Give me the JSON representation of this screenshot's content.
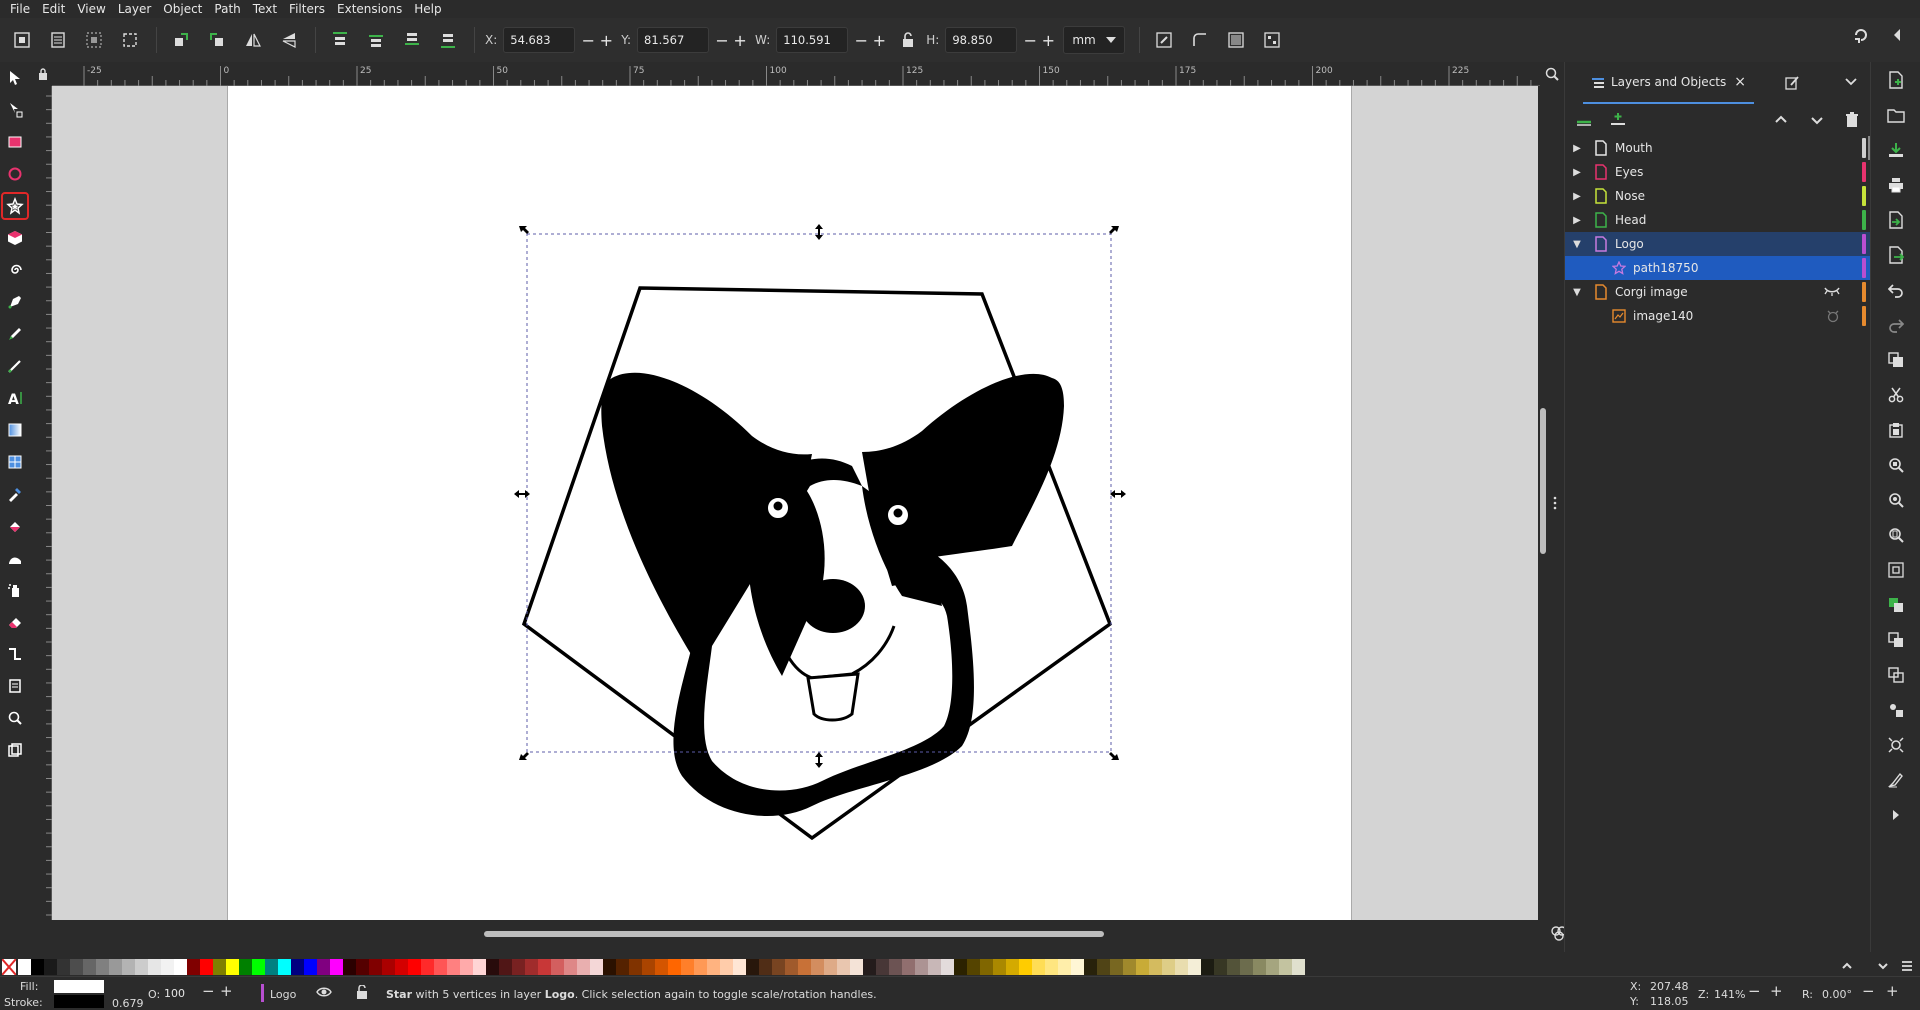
{
  "menu": [
    "File",
    "Edit",
    "View",
    "Layer",
    "Object",
    "Path",
    "Text",
    "Filters",
    "Extensions",
    "Help"
  ],
  "toolbar": {
    "x_label": "X:",
    "x_value": "54.683",
    "y_label": "Y:",
    "y_value": "81.567",
    "w_label": "W:",
    "w_value": "110.591",
    "h_label": "H:",
    "h_value": "98.850",
    "unit": "mm",
    "minus": "−",
    "plus": "+"
  },
  "ruler": {
    "top_ticks": [
      "-25",
      "0",
      "25",
      "50",
      "75",
      "100",
      "125",
      "150",
      "175",
      "200",
      "225"
    ]
  },
  "dock": {
    "tab_label": "Layers and Objects",
    "tab_close": "×",
    "layers": [
      {
        "name": "Mouth",
        "expander": "▶",
        "color": "#cfcfcf",
        "icon_color": "#e6e6e6"
      },
      {
        "name": "Eyes",
        "expander": "▶",
        "color": "#e8336e",
        "icon_color": "#e8336e"
      },
      {
        "name": "Nose",
        "expander": "▶",
        "color": "#c6e33a",
        "icon_color": "#c6e33a"
      },
      {
        "name": "Head",
        "expander": "▶",
        "color": "#3db34a",
        "icon_color": "#3db34a"
      },
      {
        "name": "Logo",
        "expander": "▼",
        "color": "#b84fd1",
        "icon_color": "#c77ae0"
      },
      {
        "name": "path18750",
        "expander": "",
        "color": "#b84fd1",
        "icon_color": "#c77ae0"
      },
      {
        "name": "Corgi image",
        "expander": "▼",
        "color": "#e68a2e",
        "icon_color": "#e68a2e"
      },
      {
        "name": "image140",
        "expander": "",
        "color": "#e68a2e",
        "icon_color": "#e68a2e"
      }
    ]
  },
  "status": {
    "fill_label": "Fill:",
    "stroke_label": "Stroke:",
    "stroke_width": "0.679",
    "opacity_label": "O:",
    "opacity_value": "100",
    "minus": "−",
    "plus": "+",
    "layer_name": "Logo",
    "message_bold": "Star",
    "message_rest": " with 5 vertices in layer ",
    "message_layer": "Logo",
    "message_tail": ". Click selection again to toggle scale/rotation handles.",
    "x_label": "X:",
    "x_value": "207.48",
    "y_label": "Y:",
    "y_value": "118.05",
    "zoom_label": "Z:",
    "zoom_value": "141%",
    "rot_label": "R:",
    "rot_value": "0.00°"
  },
  "palette": [
    "#ffffff",
    "#000000",
    "#1a1a1a",
    "#333333",
    "#4d4d4d",
    "#666666",
    "#808080",
    "#999999",
    "#b3b3b3",
    "#cccccc",
    "#e6e6e6",
    "#f2f2f2",
    "#ffffff",
    "#800000",
    "#ff0000",
    "#808000",
    "#ffff00",
    "#008000",
    "#00ff00",
    "#008080",
    "#00ffff",
    "#000080",
    "#0000ff",
    "#800080",
    "#ff00ff",
    "#2b0000",
    "#550000",
    "#800000",
    "#aa0000",
    "#d40000",
    "#ff0000",
    "#ff2a2a",
    "#ff5555",
    "#ff8080",
    "#ffaaaa",
    "#ffd5d5",
    "#280b0b",
    "#501616",
    "#782121",
    "#a02c2c",
    "#c83737",
    "#d35f5f",
    "#de8787",
    "#e9afaf",
    "#f4d7d7",
    "#2b1100",
    "#552200",
    "#803300",
    "#aa4400",
    "#d45500",
    "#ff6600",
    "#ff7f2a",
    "#ff9955",
    "#ffb380",
    "#ffccaa",
    "#ffe6d5",
    "#28170b",
    "#502d16",
    "#784421",
    "#a05a2c",
    "#c87137",
    "#d38d5f",
    "#deaa87",
    "#e9c6af",
    "#f4e3d7",
    "#241c1c",
    "#483737",
    "#6c5353",
    "#916f6f",
    "#ac9393",
    "#c8b7b7",
    "#e3dbdb",
    "#2b2200",
    "#554400",
    "#806600",
    "#aa8800",
    "#d4aa00",
    "#ffcc00",
    "#ffdd55",
    "#ffe680",
    "#ffeeaa",
    "#fff6d5",
    "#28220b",
    "#504416",
    "#786721",
    "#a0892c",
    "#c8ab37",
    "#d4bb5f",
    "#decd87",
    "#e9ddaf",
    "#f4eed7",
    "#1c1c12",
    "#373724",
    "#535339",
    "#6c6c4d",
    "#898962",
    "#a5a57f",
    "#c3c3a0",
    "#e0e0ce"
  ]
}
